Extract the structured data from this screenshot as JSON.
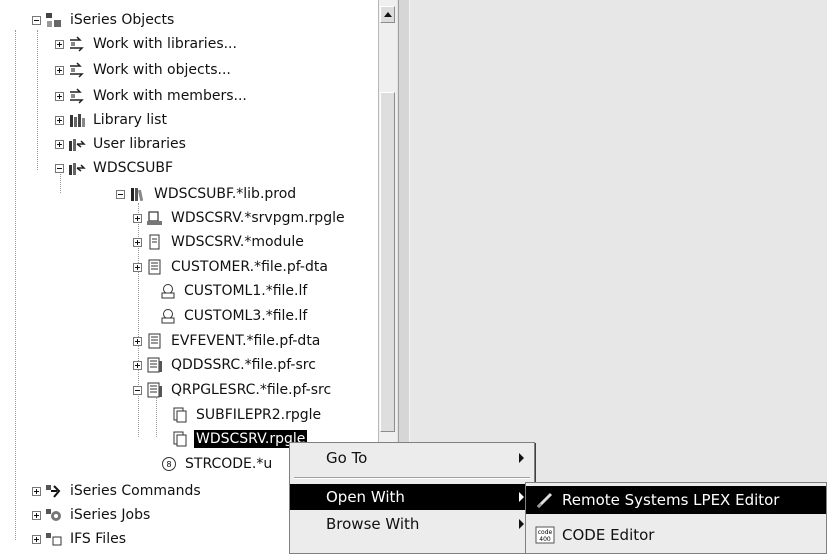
{
  "tree": {
    "items": [
      {
        "label": "iSeries Objects",
        "icon": "iseries-objects-icon"
      },
      {
        "label": "Work with libraries...",
        "icon": "work-with-filter-icon"
      },
      {
        "label": "Work with objects...",
        "icon": "work-with-filter-icon"
      },
      {
        "label": "Work with members...",
        "icon": "work-with-filter-icon"
      },
      {
        "label": "Library list",
        "icon": "library-list-icon"
      },
      {
        "label": "User libraries",
        "icon": "user-libraries-icon"
      },
      {
        "label": "WDSCSUBF",
        "icon": "filter-icon"
      },
      {
        "label": "WDSCSUBF.*lib.prod",
        "icon": "library-icon"
      },
      {
        "label": "WDSCSRV.*srvpgm.rpgle",
        "icon": "service-program-icon"
      },
      {
        "label": "WDSCSRV.*module",
        "icon": "module-icon"
      },
      {
        "label": "CUSTOMER.*file.pf-dta",
        "icon": "physical-file-icon"
      },
      {
        "label": "CUSTOML1.*file.lf",
        "icon": "logical-file-icon"
      },
      {
        "label": "CUSTOML3.*file.lf",
        "icon": "logical-file-icon"
      },
      {
        "label": "EVFEVENT.*file.pf-dta",
        "icon": "physical-file-icon"
      },
      {
        "label": "QDDSSRC.*file.pf-src",
        "icon": "source-file-icon"
      },
      {
        "label": "QRPGLESRC.*file.pf-src",
        "icon": "source-file-icon"
      },
      {
        "label": "SUBFILEPR2.rpgle",
        "icon": "member-icon"
      },
      {
        "label": "WDSCSRV.rpgle",
        "icon": "member-icon"
      },
      {
        "label": "STRCODE.*u",
        "icon": "program-icon"
      },
      {
        "label": "iSeries Commands",
        "icon": "iseries-commands-icon"
      },
      {
        "label": "iSeries Jobs",
        "icon": "iseries-jobs-icon"
      },
      {
        "label": "IFS Files",
        "icon": "ifs-files-icon"
      }
    ]
  },
  "context_menu": {
    "items": [
      {
        "label": "Go To"
      },
      {
        "label": "Open With"
      },
      {
        "label": "Browse With"
      }
    ]
  },
  "submenu": {
    "items": [
      {
        "label": "Remote Systems LPEX Editor",
        "icon": "lpex-editor-icon"
      },
      {
        "label": "CODE Editor",
        "icon": "code-editor-icon",
        "icon_text": "code\n400"
      }
    ]
  }
}
